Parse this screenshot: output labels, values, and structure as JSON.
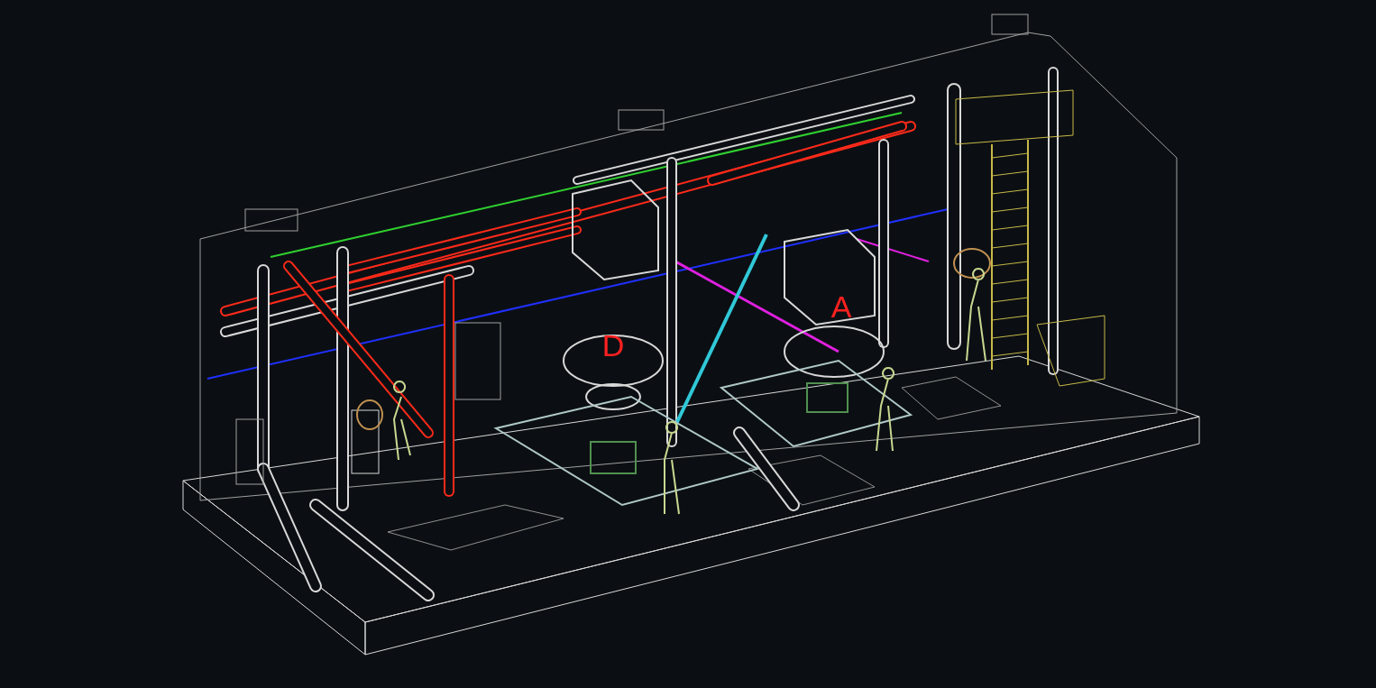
{
  "viewport": {
    "labels": [
      {
        "text": "D"
      },
      {
        "text": "A"
      }
    ]
  }
}
